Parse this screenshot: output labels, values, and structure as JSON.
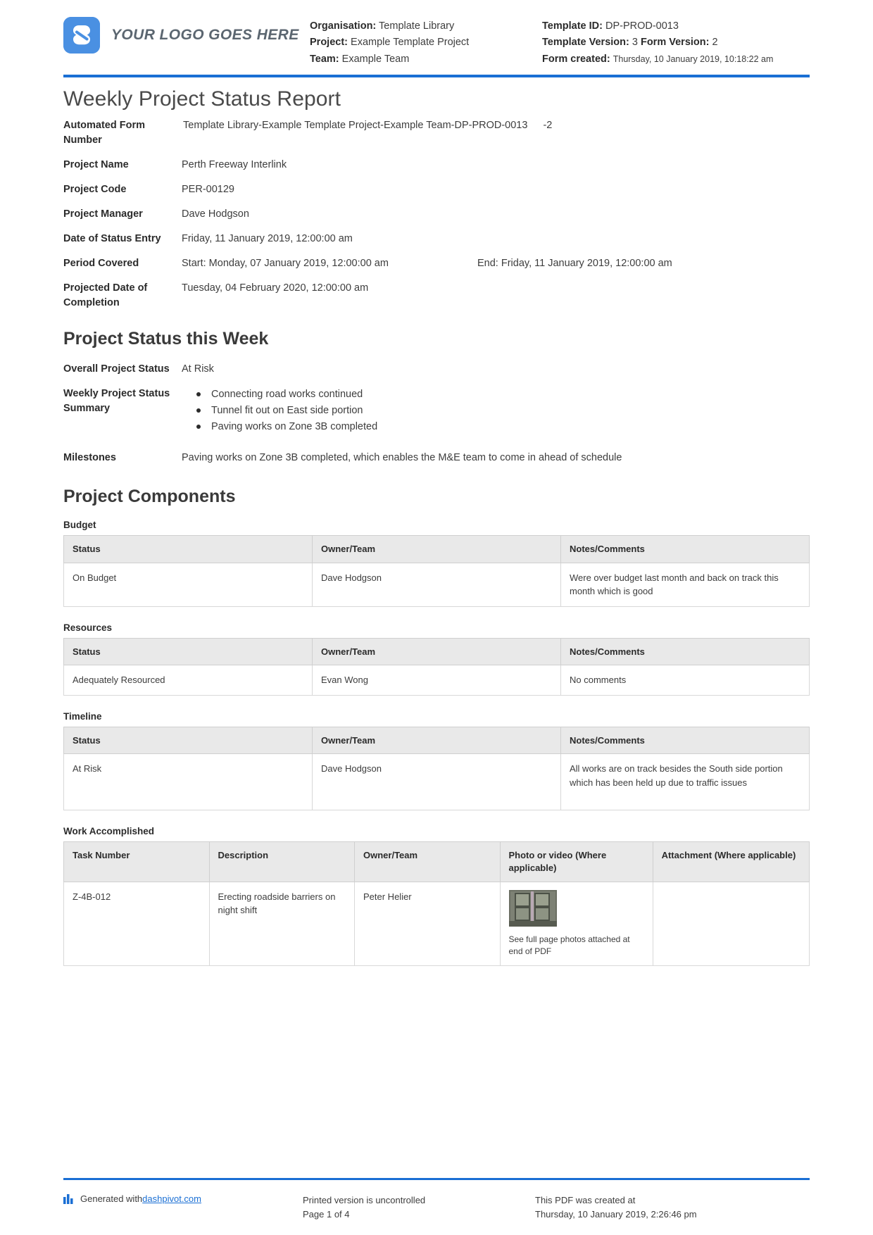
{
  "header": {
    "logo_text": "YOUR LOGO GOES HERE",
    "meta_left": [
      {
        "label": "Organisation:",
        "value": "Template Library"
      },
      {
        "label": "Project:",
        "value": "Example Template Project"
      },
      {
        "label": "Team:",
        "value": "Example Team"
      }
    ],
    "meta_right": {
      "template_id_label": "Template ID:",
      "template_id_value": "DP-PROD-0013",
      "template_version_label": "Template Version:",
      "template_version_value": "3",
      "form_version_label": "Form Version:",
      "form_version_value": "2",
      "form_created_label": "Form created:",
      "form_created_value": "Thursday, 10 January 2019, 10:18:22 am"
    }
  },
  "title": "Weekly Project Status Report",
  "fields": {
    "automated_form_number": {
      "label": "Automated Form Number",
      "value": "Template Library-Example Template Project-Example Team-DP-PROD-0013",
      "suffix": "-2"
    },
    "project_name": {
      "label": "Project Name",
      "value": "Perth Freeway Interlink"
    },
    "project_code": {
      "label": "Project Code",
      "value": "PER-00129"
    },
    "project_manager": {
      "label": "Project Manager",
      "value": "Dave Hodgson"
    },
    "date_of_status_entry": {
      "label": "Date of Status Entry",
      "value": "Friday, 11 January 2019, 12:00:00 am"
    },
    "period_covered": {
      "label": "Period Covered",
      "start": "Start: Monday, 07 January 2019, 12:00:00 am",
      "end": "End: Friday, 11 January 2019, 12:00:00 am"
    },
    "projected_completion": {
      "label": "Projected Date of Completion",
      "value": "Tuesday, 04 February 2020, 12:00:00 am"
    }
  },
  "status_section": {
    "heading": "Project Status this Week",
    "overall_status": {
      "label": "Overall Project Status",
      "value": "At Risk"
    },
    "weekly_summary": {
      "label": "Weekly Project Status Summary",
      "bullets": [
        "Connecting road works continued",
        "Tunnel fit out on East side portion",
        "Paving works on Zone 3B completed"
      ]
    },
    "milestones": {
      "label": "Milestones",
      "value": "Paving works on Zone 3B completed, which enables the M&E team to come in ahead of schedule"
    }
  },
  "components_section": {
    "heading": "Project Components",
    "common_columns": [
      "Status",
      "Owner/Team",
      "Notes/Comments"
    ],
    "budget": {
      "label": "Budget",
      "rows": [
        {
          "status": "On Budget",
          "owner": "Dave Hodgson",
          "notes": "Were over budget last month and back on track this month which is good"
        }
      ]
    },
    "resources": {
      "label": "Resources",
      "rows": [
        {
          "status": "Adequately Resourced",
          "owner": "Evan Wong",
          "notes": "No comments"
        }
      ]
    },
    "timeline": {
      "label": "Timeline",
      "rows": [
        {
          "status": "At Risk",
          "owner": "Dave Hodgson",
          "notes": "All works are on track besides the South side portion which has been held up due to traffic issues"
        }
      ]
    },
    "work_accomplished": {
      "label": "Work Accomplished",
      "columns": [
        "Task Number",
        "Description",
        "Owner/Team",
        "Photo or video (Where applicable)",
        "Attachment (Where applicable)"
      ],
      "rows": [
        {
          "task_number": "Z-4B-012",
          "description": "Erecting roadside barriers on night shift",
          "owner": "Peter Helier",
          "photo_caption": "See full page photos attached at end of PDF",
          "attachment": ""
        }
      ]
    }
  },
  "footer": {
    "generated_prefix": "Generated with ",
    "generated_link": "dashpivot.com",
    "printed_note": "Printed version is uncontrolled",
    "page_number": "Page 1 of 4",
    "created_note": "This PDF was created at",
    "created_date": "Thursday, 10 January 2019, 2:26:46 pm"
  },
  "colors": {
    "accent_blue": "#1a6fd4",
    "logo_blue": "#4a90e2",
    "table_header_bg": "#e9e9e9"
  }
}
